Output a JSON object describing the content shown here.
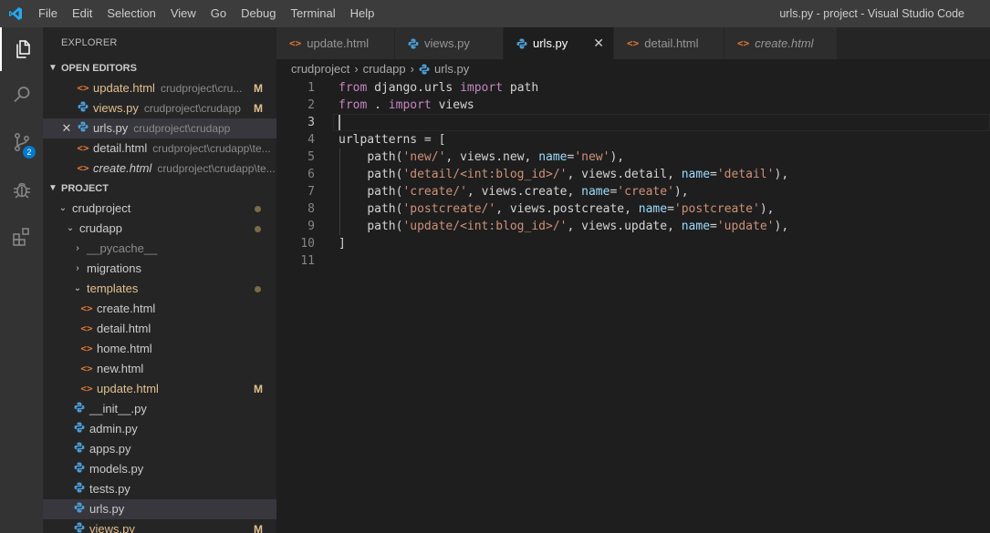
{
  "window": {
    "title": "urls.py - project - Visual Studio Code",
    "menu": [
      "File",
      "Edit",
      "Selection",
      "View",
      "Go",
      "Debug",
      "Terminal",
      "Help"
    ]
  },
  "activity": {
    "scm_badge": "2"
  },
  "sidebar": {
    "title": "EXPLORER",
    "open_editors_label": "OPEN EDITORS",
    "project_label": "PROJECT",
    "open_editors": [
      {
        "name": "update.html",
        "path": "crudproject\\cru...",
        "status": "M",
        "type": "html"
      },
      {
        "name": "views.py",
        "path": "crudproject\\crudapp",
        "status": "M",
        "type": "py"
      },
      {
        "name": "urls.py",
        "path": "crudproject\\crudapp",
        "status": "",
        "type": "py"
      },
      {
        "name": "detail.html",
        "path": "crudproject\\crudapp\\te...",
        "status": "",
        "type": "html"
      },
      {
        "name": "create.html",
        "path": "crudproject\\crudapp\\te...",
        "status": "",
        "type": "html"
      }
    ],
    "tree": [
      {
        "name": "crudproject",
        "type": "folder"
      },
      {
        "name": "crudapp",
        "type": "folder"
      },
      {
        "name": "__pycache__",
        "type": "folder"
      },
      {
        "name": "migrations",
        "type": "folder"
      },
      {
        "name": "templates",
        "type": "folder"
      },
      {
        "name": "create.html",
        "type": "html"
      },
      {
        "name": "detail.html",
        "type": "html"
      },
      {
        "name": "home.html",
        "type": "html"
      },
      {
        "name": "new.html",
        "type": "html"
      },
      {
        "name": "update.html",
        "type": "html",
        "status": "M"
      },
      {
        "name": "__init__.py",
        "type": "py"
      },
      {
        "name": "admin.py",
        "type": "py"
      },
      {
        "name": "apps.py",
        "type": "py"
      },
      {
        "name": "models.py",
        "type": "py"
      },
      {
        "name": "tests.py",
        "type": "py"
      },
      {
        "name": "urls.py",
        "type": "py"
      },
      {
        "name": "views.py",
        "type": "py",
        "status": "M"
      }
    ]
  },
  "tabs": [
    {
      "label": "update.html",
      "type": "html"
    },
    {
      "label": "views.py",
      "type": "py"
    },
    {
      "label": "urls.py",
      "type": "py",
      "active": true
    },
    {
      "label": "detail.html",
      "type": "html"
    },
    {
      "label": "create.html",
      "type": "html"
    }
  ],
  "breadcrumb": [
    "crudproject",
    "crudapp",
    "urls.py"
  ],
  "editor": {
    "line_numbers": [
      "1",
      "2",
      "3",
      "4",
      "5",
      "6",
      "7",
      "8",
      "9",
      "10",
      "11"
    ],
    "lines": [
      "from django.urls import path",
      "from . import views",
      "",
      "urlpatterns = [",
      "    path('new/', views.new, name='new'),",
      "    path('detail/<int:blog_id>/', views.detail, name='detail'),",
      "    path('create/', views.create, name='create'),",
      "    path('postcreate/', views.postcreate, name='postcreate'),",
      "    path('update/<int:blog_id>/', views.update, name='update'),",
      "]",
      ""
    ]
  },
  "colors": {
    "accent": "#007acc",
    "modified": "#e2c08d",
    "html_icon": "#e37933",
    "python_icon": "#4b9cd3"
  }
}
